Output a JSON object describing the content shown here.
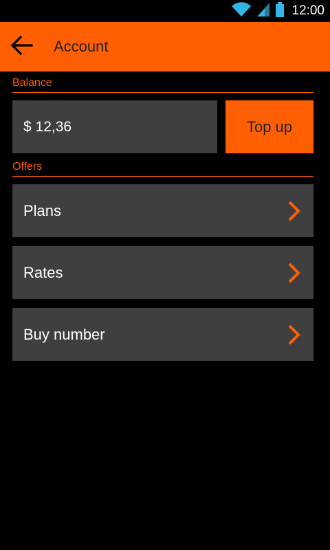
{
  "status_bar": {
    "time": "12:00",
    "icons": [
      "wifi-icon",
      "signal-icon",
      "battery-icon"
    ],
    "icon_color": "#33b5e5"
  },
  "action_bar": {
    "title": "Account",
    "back_icon": "arrow-left-icon"
  },
  "balance_section": {
    "header": "Balance",
    "amount": "$ 12,36",
    "top_up_label": "Top up"
  },
  "offers_section": {
    "header": "Offers",
    "items": [
      {
        "label": "Plans",
        "icon": "chevron-right-icon"
      },
      {
        "label": "Rates",
        "icon": "chevron-right-icon"
      },
      {
        "label": "Buy number",
        "icon": "chevron-right-icon"
      }
    ]
  },
  "colors": {
    "accent": "#ff5f00",
    "card": "#3f3f3f",
    "background": "#000000"
  }
}
